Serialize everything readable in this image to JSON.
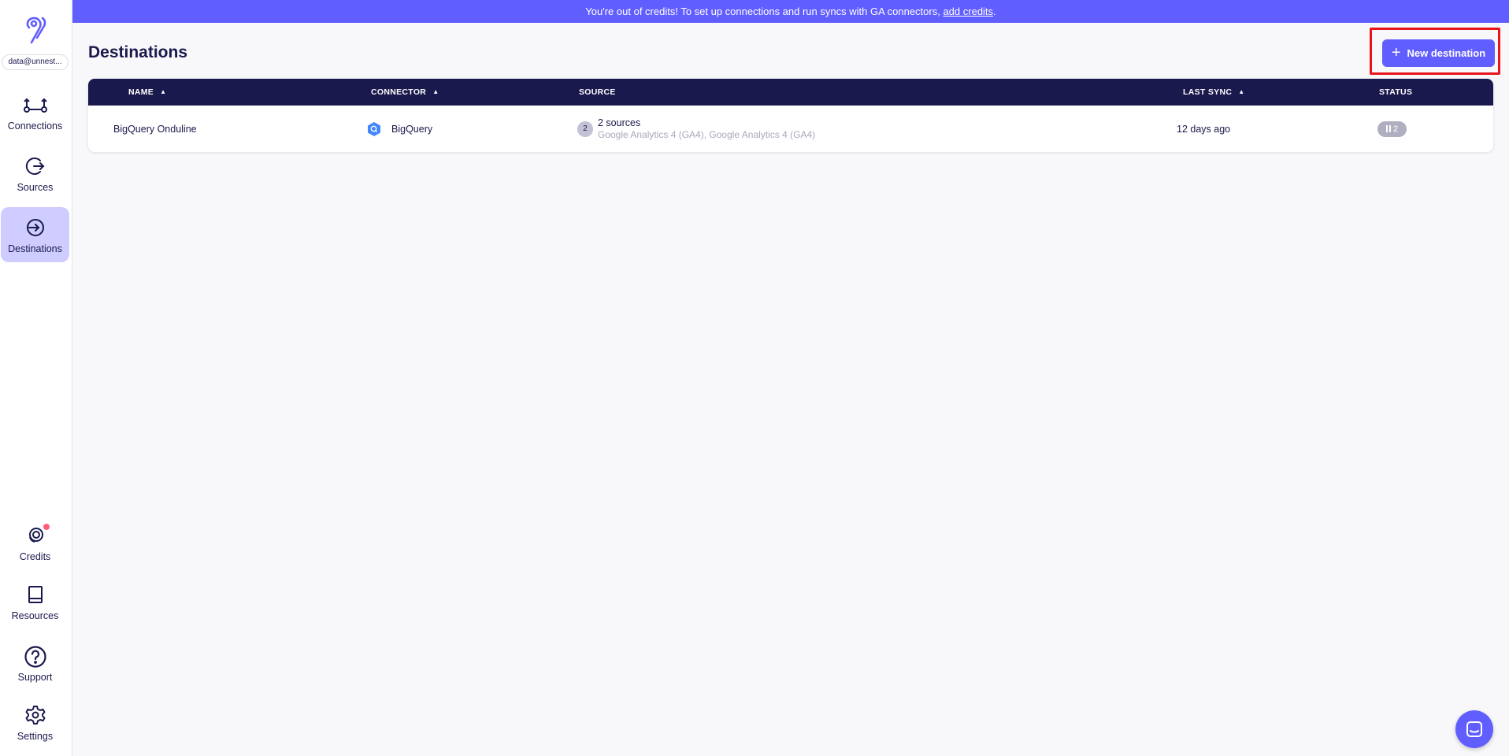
{
  "workspace": {
    "name": "data@unnest..."
  },
  "banner": {
    "text": "You're out of credits! To set up connections and run syncs with GA connectors, ",
    "link": "add credits",
    "suffix": "."
  },
  "nav": {
    "connections": "Connections",
    "sources": "Sources",
    "destinations": "Destinations",
    "credits": "Credits",
    "resources": "Resources",
    "support": "Support",
    "settings": "Settings"
  },
  "page": {
    "title": "Destinations",
    "new_button": "New destination"
  },
  "table": {
    "headers": {
      "name": "NAME",
      "connector": "CONNECTOR",
      "source": "SOURCE",
      "last_sync": "LAST SYNC",
      "status": "STATUS"
    },
    "rows": [
      {
        "name": "BigQuery Onduline",
        "connector": "BigQuery",
        "source_count_badge": "2",
        "source_count_text": "2 sources",
        "source_names": "Google Analytics 4 (GA4), Google Analytics 4 (GA4)",
        "last_sync": "12 days ago",
        "status_count": "2"
      }
    ]
  },
  "colors": {
    "accent": "#615eff",
    "header_bg": "#1a194d",
    "active_nav": "#cfcdff",
    "highlight": "#e8141b"
  }
}
